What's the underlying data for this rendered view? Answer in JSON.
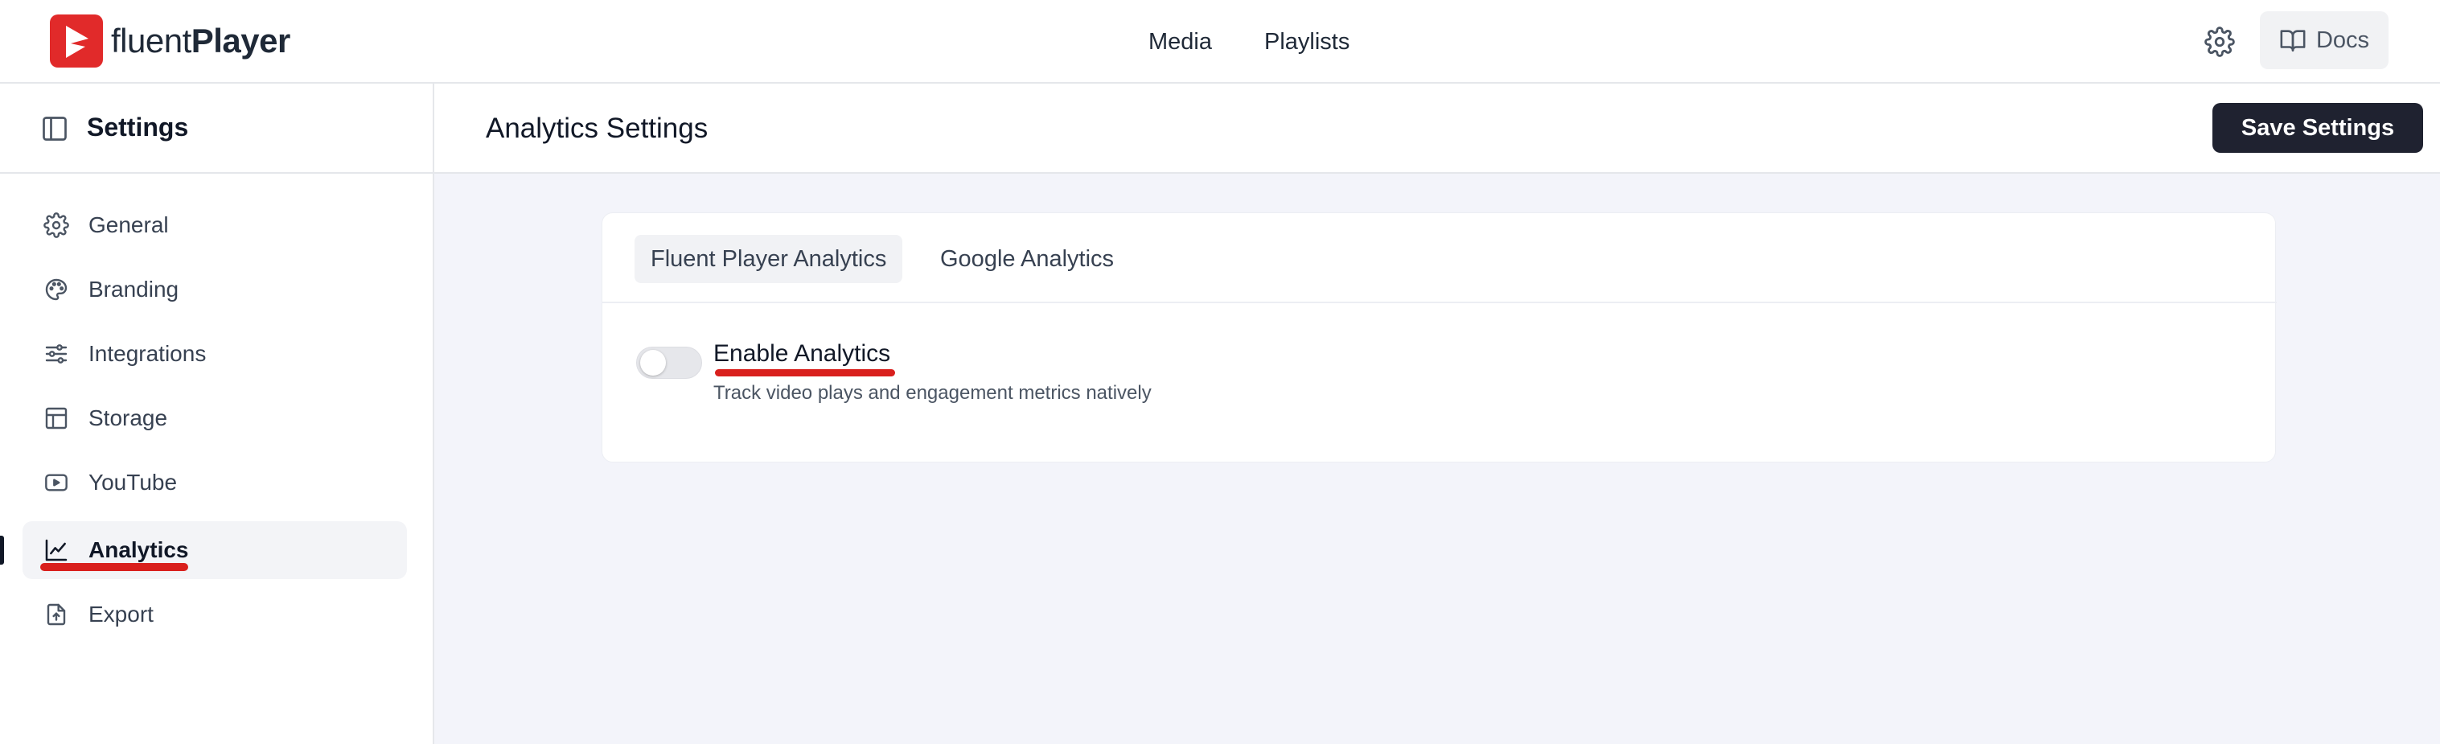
{
  "brand": {
    "name_light": "fluent",
    "name_bold": "Player",
    "accent": "#e12a2a"
  },
  "topnav": {
    "items": [
      {
        "label": "Media"
      },
      {
        "label": "Playlists"
      }
    ],
    "settings_icon": "gear-icon",
    "docs_label": "Docs",
    "docs_icon": "book-open-icon"
  },
  "sidebar": {
    "title": "Settings",
    "toggle_icon": "sidebar-panel-icon",
    "items": [
      {
        "label": "General",
        "icon": "gear-icon",
        "active": false
      },
      {
        "label": "Branding",
        "icon": "palette-icon",
        "active": false
      },
      {
        "label": "Integrations",
        "icon": "sliders-icon",
        "active": false
      },
      {
        "label": "Storage",
        "icon": "layout-icon",
        "active": false
      },
      {
        "label": "YouTube",
        "icon": "youtube-icon",
        "active": false
      },
      {
        "label": "Analytics",
        "icon": "chart-line-icon",
        "active": true
      },
      {
        "label": "Export",
        "icon": "file-export-icon",
        "active": false
      }
    ]
  },
  "content": {
    "title": "Analytics Settings",
    "save_label": "Save Settings",
    "tabs": [
      {
        "label": "Fluent Player Analytics",
        "active": true
      },
      {
        "label": "Google Analytics",
        "active": false
      }
    ],
    "option": {
      "label": "Enable Analytics",
      "description": "Track video plays and engagement metrics natively",
      "enabled": false
    }
  },
  "colors": {
    "highlight": "#d9201d",
    "save_button": "#1f2230",
    "body_bg": "#f3f4fa"
  }
}
